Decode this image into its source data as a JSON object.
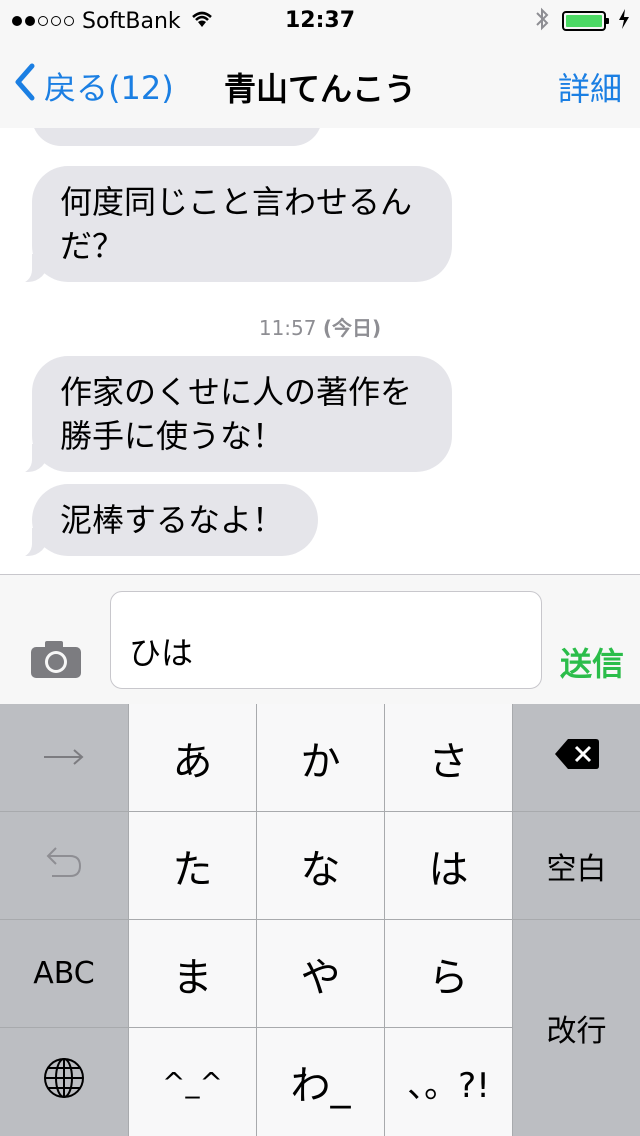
{
  "status_bar": {
    "carrier": "SoftBank",
    "time": "12:37",
    "signal_bars": 2,
    "battery_level": 1.0
  },
  "nav": {
    "back_label": "戻る(12)",
    "title": "青山てんこう",
    "detail_label": "詳細"
  },
  "messages": {
    "items": [
      {
        "line1": "何度同じこと言わせるん",
        "line2": "だ？"
      },
      {
        "line1": "作家のくせに人の著作を",
        "line2": "勝手に使うな！"
      },
      {
        "line1": "泥棒するなよ！",
        "line2": ""
      }
    ],
    "timestamp_time": "11:57",
    "timestamp_day": "(今日)"
  },
  "input": {
    "value": "ひは",
    "send_label": "送信"
  },
  "keyboard": {
    "keys": {
      "a": "あ",
      "ka": "か",
      "sa": "さ",
      "ta": "た",
      "na": "な",
      "ha": "は",
      "ma": "ま",
      "ya": "や",
      "ra": "ら",
      "kaomoji": "^_^",
      "wa": "わ_",
      "punct": "、。?!"
    },
    "abc_label": "ABC",
    "space_label": "空白",
    "return_label": "改行"
  },
  "colors": {
    "accent": "#1b7fe3",
    "send": "#2bbd4a",
    "bubble": "#e5e5ea",
    "battery": "#4cd964"
  },
  "icons": [
    "wifi-icon",
    "bluetooth-icon",
    "battery-icon",
    "back-chevron-icon",
    "camera-icon",
    "arrow-right-icon",
    "undo-icon",
    "globe-icon",
    "delete-icon"
  ]
}
